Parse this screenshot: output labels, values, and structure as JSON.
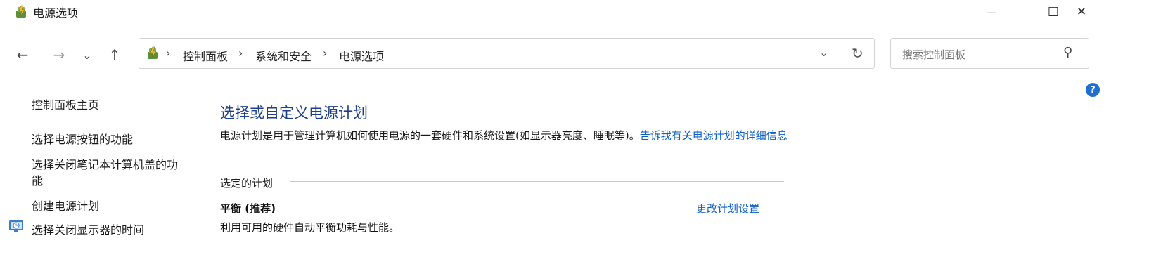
{
  "window": {
    "title": "电源选项",
    "minimize_glyph": "—",
    "maximize_glyph": "☐",
    "close_glyph": "✕"
  },
  "nav": {
    "back_glyph": "←",
    "forward_glyph": "→",
    "recent_glyph": "⌄",
    "up_glyph": "↑"
  },
  "address": {
    "separator": "›",
    "crumbs": [
      "控制面板",
      "系统和安全",
      "电源选项"
    ],
    "dropdown_glyph": "⌄",
    "refresh_glyph": "↻"
  },
  "search": {
    "placeholder": "搜索控制面板",
    "icon_glyph": "⚲"
  },
  "sidebar": {
    "home": "控制面板主页",
    "items": [
      "选择电源按钮的功能",
      "选择关闭笔记本计算机盖的功",
      "能",
      "创建电源计划",
      "选择关闭显示器的时间"
    ]
  },
  "main": {
    "heading": "选择或自定义电源计划",
    "description": "电源计划是用于管理计算机如何使用电源的一套硬件和系统设置(如显示器亮度、睡眠等)。",
    "description_link": "告诉我有关电源计划的详细信息",
    "selected_label": "选定的计划",
    "plan_name": "平衡 (推荐)",
    "plan_description": "利用可用的硬件自动平衡功耗与性能。",
    "change_plan_link": "更改计划设置"
  },
  "help": {
    "glyph": "?"
  },
  "colors": {
    "link": "#0f5fc6",
    "heading": "#1e3f8a",
    "help_badge": "#1f6fd1"
  }
}
